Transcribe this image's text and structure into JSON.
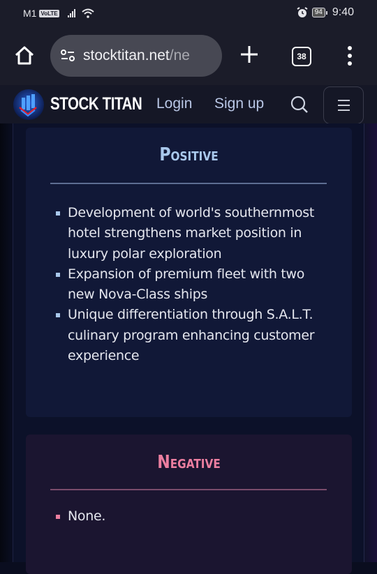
{
  "status_bar": {
    "carrier": "M1",
    "network_badge": "VoLTE",
    "battery": "94",
    "time": "9:40"
  },
  "browser": {
    "url_domain": "stocktitan.net",
    "url_path": "/ne",
    "tab_count": "38"
  },
  "site_header": {
    "brand": "STOCK TITAN",
    "login_label": "Login",
    "signup_label": "Sign up"
  },
  "positive": {
    "title": "Positive",
    "accent_color": "#a9c8ec",
    "items": [
      "Development of world's southernmost hotel strengthens market position in luxury polar exploration",
      "Expansion of premium fleet with two new Nova-Class ships",
      "Unique differentiation through S.A.L.T. culinary program enhancing customer experience"
    ]
  },
  "negative": {
    "title": "Negative",
    "accent_color": "#ec7ea0",
    "items": [
      "None."
    ]
  }
}
